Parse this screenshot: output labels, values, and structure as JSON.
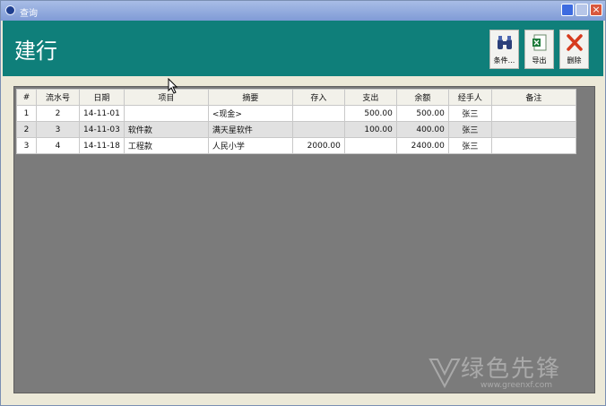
{
  "window": {
    "title": "查询"
  },
  "header": {
    "title": "建行"
  },
  "toolbar": {
    "filter_label": "条件...",
    "export_label": "导出",
    "delete_label": "删除"
  },
  "table": {
    "columns": [
      "#",
      "流水号",
      "日期",
      "项目",
      "摘要",
      "存入",
      "支出",
      "余额",
      "经手人",
      "备注"
    ],
    "rows": [
      {
        "idx": "1",
        "serial": "2",
        "date": "14-11-01",
        "item": "",
        "summary": "<现金>",
        "deposit": "",
        "expense": "500.00",
        "balance": "500.00",
        "handler": "张三",
        "note": ""
      },
      {
        "idx": "2",
        "serial": "3",
        "date": "14-11-03",
        "item": "软件款",
        "summary": "满天星软件",
        "deposit": "",
        "expense": "100.00",
        "balance": "400.00",
        "handler": "张三",
        "note": ""
      },
      {
        "idx": "3",
        "serial": "4",
        "date": "14-11-18",
        "item": "工程款",
        "summary": "人民小学",
        "deposit": "2000.00",
        "expense": "",
        "balance": "2400.00",
        "handler": "张三",
        "note": ""
      }
    ]
  },
  "watermark": {
    "text": "绿色先锋",
    "url": "www.greenxf.com"
  },
  "colors": {
    "header_bg": "#0f7f7a",
    "titlebar": "#8aa6dd",
    "content_bg": "#7b7b7b"
  }
}
